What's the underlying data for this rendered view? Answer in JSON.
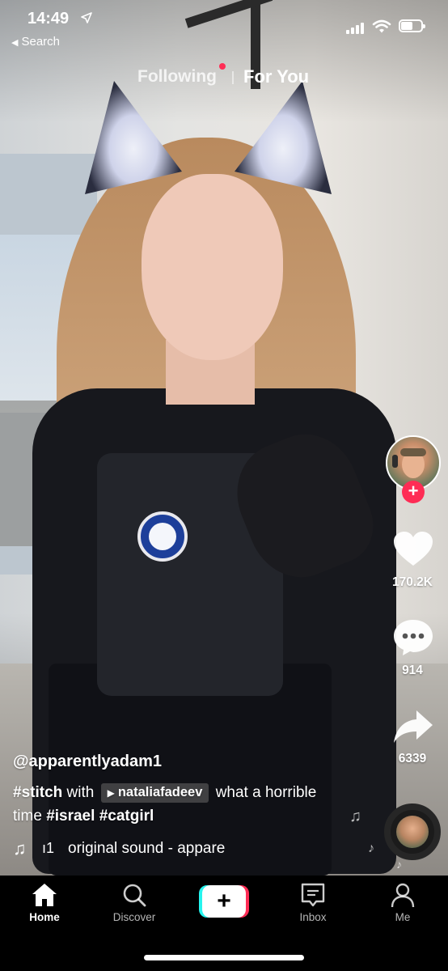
{
  "status_bar": {
    "time": "14:49",
    "back_label": "Search"
  },
  "top_tabs": {
    "following": "Following",
    "for_you": "For You"
  },
  "right_rail": {
    "likes": "170.2K",
    "comments": "914",
    "shares": "6339"
  },
  "caption": {
    "username": "@apparentlyadam1",
    "hashtag_stitch": "#stitch",
    "with_text": "with",
    "stitched_user": "nataliafadeev",
    "text_part1": "what a horrible",
    "text_part2": "time",
    "hashtag_israel": "#israel",
    "hashtag_catgirl": "#catgirl"
  },
  "sound": {
    "prefix": "ı1",
    "text": "original sound - appare"
  },
  "bottom_nav": {
    "items": [
      {
        "label": "Home",
        "icon": "home-icon"
      },
      {
        "label": "Discover",
        "icon": "search-icon"
      },
      {
        "label": "",
        "icon": "plus-icon"
      },
      {
        "label": "Inbox",
        "icon": "inbox-icon"
      },
      {
        "label": "Me",
        "icon": "person-icon"
      }
    ]
  },
  "colors": {
    "accent_red": "#fe2c55",
    "accent_cyan": "#25f4ee"
  }
}
